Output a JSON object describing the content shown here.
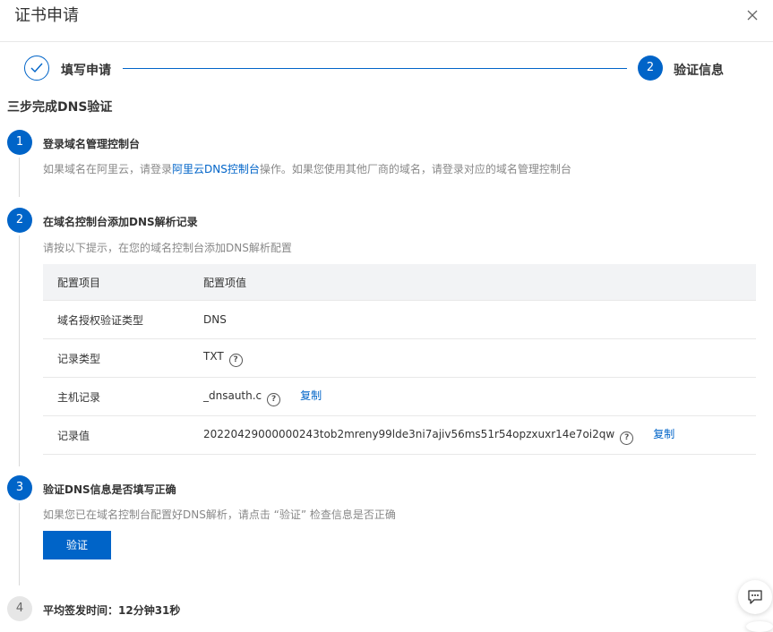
{
  "dialog": {
    "title": "证书申请"
  },
  "stepper": {
    "step1_label": "填写申请",
    "step2_number": "2",
    "step2_label": "验证信息"
  },
  "section_title": "三步完成DNS验证",
  "steps": [
    {
      "number": "1",
      "title": "登录域名管理控制台",
      "desc_prefix": "如果域名在阿里云，请登录",
      "desc_link": "阿里云DNS控制台",
      "desc_suffix": "操作。如果您使用其他厂商的域名，请登录对应的域名管理控制台"
    },
    {
      "number": "2",
      "title": "在域名控制台添加DNS解析记录",
      "desc": "请按以下提示，在您的域名控制台添加DNS解析配置"
    },
    {
      "number": "3",
      "title": "验证DNS信息是否填写正确",
      "desc": "如果您已在域名控制台配置好DNS解析，请点击 “验证” 检查信息是否正确"
    },
    {
      "number": "4",
      "title": "平均签发时间：12分钟31秒"
    }
  ],
  "dns_table": {
    "headers": [
      "配置项目",
      "配置项值"
    ],
    "rows": [
      {
        "label": "域名授权验证类型",
        "value": "DNS"
      },
      {
        "label": "记录类型",
        "value": "TXT"
      },
      {
        "label": "主机记录",
        "value": "_dnsauth.c"
      },
      {
        "label": "记录值",
        "value": "20220429000000243tob2mreny99lde3ni7ajiv56ms51r54opzxuxr14e7oi2qw"
      }
    ],
    "copy_label": "复制",
    "help_glyph": "?"
  },
  "verify_button": "验证",
  "colors": {
    "primary": "#0064c8",
    "header_bg": "#f2f3f5",
    "muted_text": "#888888"
  },
  "icons": [
    "check-icon",
    "close-icon",
    "help-icon",
    "chat-icon"
  ]
}
